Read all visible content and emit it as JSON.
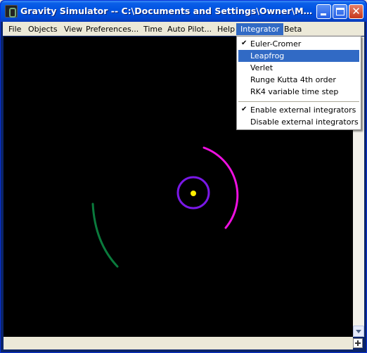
{
  "window": {
    "title": "Gravity Simulator -- C:\\Documents and Settings\\Owner\\My Documents\\...",
    "controls": {
      "minimize": "minimize-icon",
      "maximize": "maximize-icon",
      "close": "close-icon",
      "close_glyph": "✕"
    }
  },
  "menubar": {
    "items": [
      {
        "label": "File"
      },
      {
        "label": "Objects"
      },
      {
        "label": "View"
      },
      {
        "label": "Preferences..."
      },
      {
        "label": "Time"
      },
      {
        "label": "Auto Pilot..."
      },
      {
        "label": "Help"
      },
      {
        "label": "Integrator",
        "open": true
      },
      {
        "label": "Beta"
      }
    ]
  },
  "integrator_menu": {
    "items": [
      {
        "label": "Euler-Cromer",
        "checked": true
      },
      {
        "label": "Leapfrog",
        "highlighted": true
      },
      {
        "label": "Verlet"
      },
      {
        "label": "Runge Kutta 4th order"
      },
      {
        "label": "RK4 variable time step"
      },
      {
        "label": "Enable external integrators",
        "checked": true
      },
      {
        "label": "Disable external integrators"
      }
    ],
    "check_glyph": "✔"
  },
  "simulation": {
    "colors": {
      "background": "#000000",
      "sun": "#ffee00",
      "inner_orbit": "#7a18e6",
      "magenta_orbit": "#ee10e0",
      "green_orbit": "#0a7a3c"
    }
  }
}
